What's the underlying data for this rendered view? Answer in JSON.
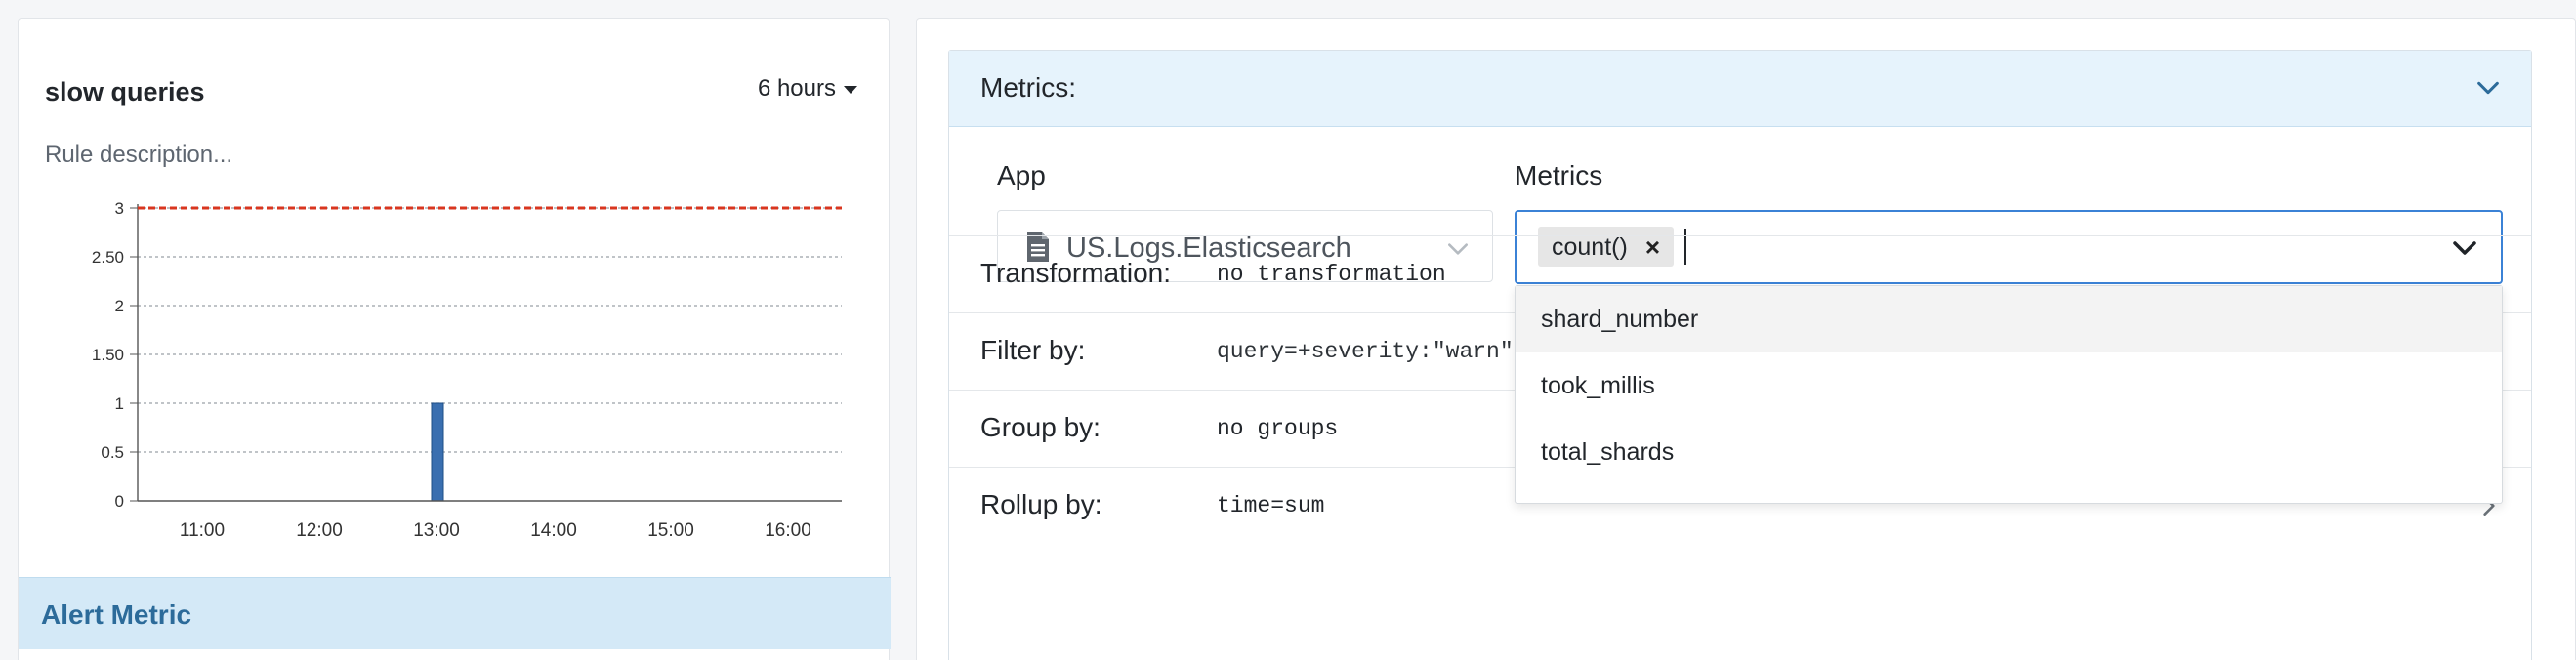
{
  "left": {
    "title": "slow queries",
    "range_label": "6 hours",
    "description": "Rule description...",
    "alert_metric_title": "Alert Metric"
  },
  "chart_data": {
    "type": "bar",
    "x": [
      "13:00"
    ],
    "values": [
      1
    ],
    "xticks": [
      "11:00",
      "12:00",
      "13:00",
      "14:00",
      "15:00",
      "16:00"
    ],
    "yticks": [
      "0",
      "0.5",
      "1",
      "1.50",
      "2",
      "2.50",
      "3"
    ],
    "ylim": [
      0,
      3
    ],
    "threshold": 3,
    "threshold_color": "#d9361f",
    "bar_color": "#3a6fb0",
    "grid": true,
    "title": "",
    "xlabel": "",
    "ylabel": ""
  },
  "metrics_panel": {
    "header_title": "Metrics:",
    "app_label": "App",
    "app_value": "US.Logs.Elasticsearch",
    "metrics_label": "Metrics",
    "selected_metric": "count()",
    "chip_remove": "×",
    "dropdown_options": [
      "shard_number",
      "took_millis",
      "total_shards"
    ],
    "rows": [
      {
        "label": "Transformation:",
        "value": "no transformation"
      },
      {
        "label": "Filter by:",
        "value": "query=+severity:\"warn\" +logsource.name:\"/var/log/elasticsearch/Dummench-es-logs_index_search_slowlog.log\""
      },
      {
        "label": "Group by:",
        "value": "no groups"
      },
      {
        "label": "Rollup by:",
        "value": "time=sum"
      }
    ]
  },
  "colors": {
    "accent": "#3b82d6",
    "header_bg": "#e6f3fc",
    "alert_metric_bg": "#d4e9f7"
  }
}
